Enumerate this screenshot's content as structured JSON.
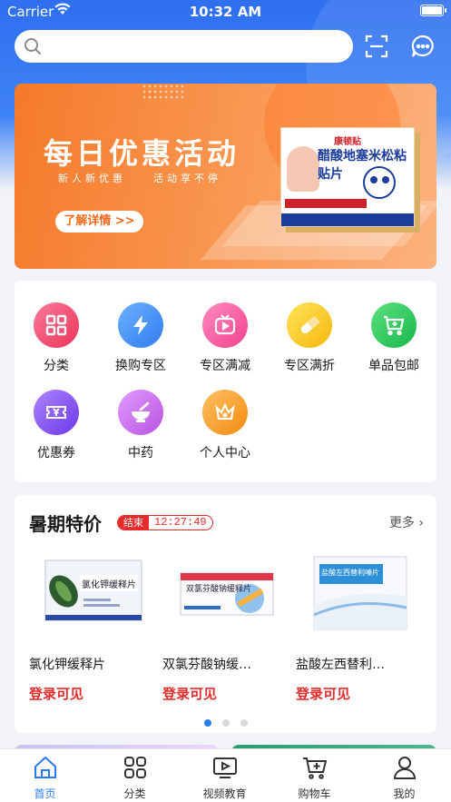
{
  "status_bar": {
    "carrier": "Carrier",
    "time": "10:32 AM"
  },
  "search": {
    "placeholder": ""
  },
  "banner": {
    "title": "每日优惠活动",
    "subtitle": "新人新优惠　　活动享不停",
    "button_label": "了解详情 >>",
    "product_brand": "康顿贴",
    "product_name": "醋酸地塞米松粘贴片"
  },
  "menu": {
    "items": [
      {
        "label": "分类",
        "icon": "grid-icon",
        "color": "#f04a6a"
      },
      {
        "label": "换购专区",
        "icon": "lightning-icon",
        "color": "#3f8df5"
      },
      {
        "label": "专区满减",
        "icon": "tv-icon",
        "color": "#f25a9c"
      },
      {
        "label": "专区满折",
        "icon": "pill-icon",
        "color": "#f6c821"
      },
      {
        "label": "单品包邮",
        "icon": "cart-icon",
        "color": "#26c65c"
      },
      {
        "label": "优惠券",
        "icon": "coupon-icon",
        "color": "#8a55f0"
      },
      {
        "label": "中药",
        "icon": "mortar-icon",
        "color": "#c86ce8"
      },
      {
        "label": "个人中心",
        "icon": "crown-icon",
        "color": "#f5a02b"
      }
    ]
  },
  "deal": {
    "title": "暑期特价",
    "badge_status": "结束",
    "badge_time": "12:27:49",
    "more_label": "更多 ›",
    "goods": [
      {
        "name": "氯化钾缓释片",
        "price": "登录可见",
        "box_label": "氯化钾缓释片"
      },
      {
        "name": "双氯芬酸钠缓…",
        "price": "登录可见",
        "box_label": "双氯芬酸钠缓释片"
      },
      {
        "name": "盐酸左西替利…",
        "price": "登录可见",
        "box_label": "盐酸左西替利嗪片"
      }
    ]
  },
  "tabbar": {
    "items": [
      {
        "label": "首页",
        "icon": "home-icon",
        "active": true
      },
      {
        "label": "分类",
        "icon": "category-icon",
        "active": false
      },
      {
        "label": "视频教育",
        "icon": "video-icon",
        "active": false
      },
      {
        "label": "购物车",
        "icon": "cart-icon",
        "active": false
      },
      {
        "label": "我的",
        "icon": "user-icon",
        "active": false
      }
    ]
  },
  "colors": {
    "accent": "#2a7cf2",
    "price_red": "#e52b2b",
    "banner_orange": "#f57a2a"
  }
}
